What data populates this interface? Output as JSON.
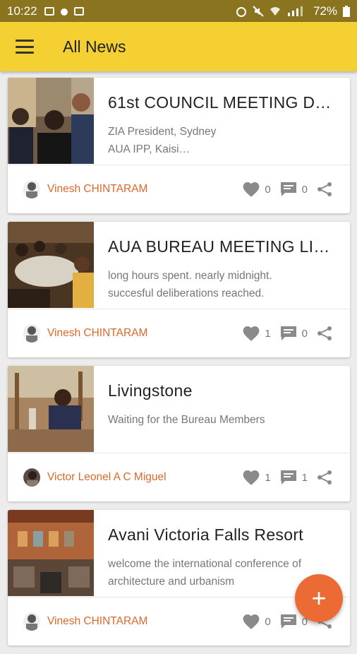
{
  "status_bar": {
    "time": "10:22",
    "battery": "72%"
  },
  "app_bar": {
    "title": "All News",
    "menu_icon": "hamburger-menu-icon"
  },
  "colors": {
    "app_bar": "#f5d032",
    "status_bar": "#8a7420",
    "author": "#d9692c",
    "fab": "#ec6b35"
  },
  "news": [
    {
      "title": "61st COUNCIL MEETING D…",
      "desc_line1": "ZIA President,  Sydney",
      "desc_line2": "AUA IPP, Kaisi…",
      "author": "Vinesh CHINTARAM",
      "likes": "0",
      "comments": "0"
    },
    {
      "title": "AUA BUREAU MEETING LI…",
      "desc_line1": "long hours spent. nearly midnight.",
      "desc_line2": "succesful deliberations reached.",
      "author": "Vinesh CHINTARAM",
      "likes": "1",
      "comments": "0"
    },
    {
      "title": "Livingstone",
      "desc_line1": "Waiting for the Bureau Members",
      "desc_line2": "",
      "author": "Victor Leonel A C Miguel",
      "likes": "1",
      "comments": "1"
    },
    {
      "title": "Avani Victoria Falls Resort",
      "desc_line1": "welcome the international conference of",
      "desc_line2": "architecture and urbanism",
      "author": "Vinesh CHINTARAM",
      "likes": "0",
      "comments": "0"
    }
  ],
  "fab": {
    "label": "+"
  }
}
